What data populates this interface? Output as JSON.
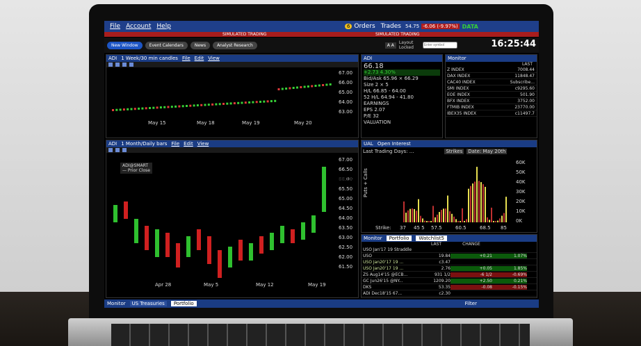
{
  "menubar": {
    "file": "File",
    "account": "Account",
    "help": "Help",
    "orders_badge": "6",
    "orders": "Orders",
    "trades": "Trades",
    "pnl": "54.75",
    "chg": "-6.06 (-9.97%)",
    "data": "DATA"
  },
  "sim": {
    "left": "SIMULATED TRADING",
    "right": "SIMULATED TRADING"
  },
  "toolbar": {
    "new_window": "New Window",
    "event": "Event Calendars",
    "news": "News",
    "analyst": "Analyst Research",
    "aa": "A A",
    "layout": "Layout Locked",
    "search_ph": "Enter symbol",
    "clock": "16:25:44"
  },
  "chart1": {
    "symbol": "ADI",
    "period": "1 Week/30 min candles",
    "file": "File",
    "edit": "Edit",
    "view": "View",
    "yticks": [
      "67.00",
      "66.00",
      "65.00",
      "64.00",
      "63.00"
    ],
    "last": "66.18",
    "xlabels": [
      "May 15",
      "May 18",
      "May 19",
      "May 20"
    ]
  },
  "quote": {
    "symbol": "ADI",
    "price": "66.18",
    "change": "+2.73  4.30%",
    "bidask": "Bid/Ask  65.96 × 66.29",
    "size": "Size         2 × 5",
    "hl": "H/L     66.85 - 64.00",
    "w52": "52 H/L  64.94 - 41.80",
    "earnings": "EARNINGS",
    "eps": "EPS        2.07",
    "pe": "P/E        32",
    "valuation": "VALUATION"
  },
  "monitor": {
    "title": "Monitor",
    "last": "LAST",
    "rows": [
      {
        "n": "Z INDEX",
        "v": "7008.44"
      },
      {
        "n": "DAX INDEX",
        "v": "11848.47"
      },
      {
        "n": "CAC40 INDEX",
        "v": "Subscribe..."
      },
      {
        "n": "SMI INDEX",
        "v": "c9295.60"
      },
      {
        "n": "EOE INDEX",
        "v": "501.90"
      },
      {
        "n": "BFX INDEX",
        "v": "3752.00"
      },
      {
        "n": "FTMIB INDEX",
        "v": "23770.00"
      },
      {
        "n": "IBEX35 INDEX",
        "v": "c11497.7"
      }
    ]
  },
  "chart2": {
    "symbol": "ADI",
    "period": "1 Month/Daily bars",
    "file": "File",
    "edit": "Edit",
    "view": "View",
    "legend1": "ADI@SMART",
    "legend2": "— Prior Close",
    "yticks": [
      "67.00",
      "66.50",
      "66.00",
      "65.50",
      "65.00",
      "64.50",
      "64.00",
      "63.50",
      "63.00",
      "62.50",
      "62.00",
      "61.50"
    ],
    "last": "66.18",
    "xlabels": [
      "Apr 28",
      "May 5",
      "May 12",
      "May 19"
    ]
  },
  "oi": {
    "symbol": "UAL",
    "title": "Open Interest",
    "days": "Last Trading Days:  ...",
    "strikes": "Strikes",
    "date": "Date: May 20th",
    "ylabel": "Puts + Calls",
    "yticks": [
      "60K",
      "50K",
      "40K",
      "30K",
      "20K",
      "10K",
      "0K"
    ],
    "xlabels": [
      "Strike:",
      "37",
      "45 5",
      "57.5",
      "60.5",
      "68.5",
      "85"
    ]
  },
  "watch": {
    "monitor": "Monitor",
    "portfolio": "Portfolio",
    "watchlist": "Watchlist5",
    "last": "LAST",
    "change": "CHANGE",
    "rows": [
      {
        "n": "USO Jan'17 19 Straddle",
        "l": "",
        "c": "",
        "p": ""
      },
      {
        "n": "USO",
        "l": "19.84",
        "c": "+0.21",
        "p": "1.07%"
      },
      {
        "n": "USO Jan20'17 19 ...",
        "l": "c3.47",
        "c": "",
        "p": ""
      },
      {
        "n": "USO Jan20'17 19 ...",
        "l": "2.76",
        "c": "+0.05",
        "p": "1.85%"
      },
      {
        "n": "ZS Aug14'15 @ECB...",
        "l": "931 1/2",
        "c": "-6 1/2",
        "p": "-0.69%"
      },
      {
        "n": "GC Jun26'15 @NY...",
        "l": "1209.20",
        "c": "+2.50",
        "p": "0.21%"
      },
      {
        "n": "DKS",
        "l": "53.35",
        "c": "-0.08",
        "p": "-0.15%"
      },
      {
        "n": "ADI Dec18'15 67...",
        "l": "c2.30",
        "c": "",
        "p": ""
      }
    ]
  },
  "bottom": {
    "monitor": "Monitor",
    "us": "US Treasuries",
    "portfolio": "Portfolio",
    "filter": "Filter"
  }
}
